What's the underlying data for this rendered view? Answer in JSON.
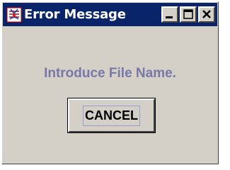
{
  "window": {
    "title": "Error Message",
    "icon": "app-icon",
    "controls": {
      "minimize_icon": "minimize-icon",
      "maximize_icon": "maximize-icon",
      "close_icon": "close-icon"
    }
  },
  "dialog": {
    "message": "Introduce File Name.",
    "cancel_label": "CANCEL"
  },
  "colors": {
    "titlebar": "#0a246a",
    "window_bg": "#d4d0c8",
    "message_text": "#7878a8"
  }
}
